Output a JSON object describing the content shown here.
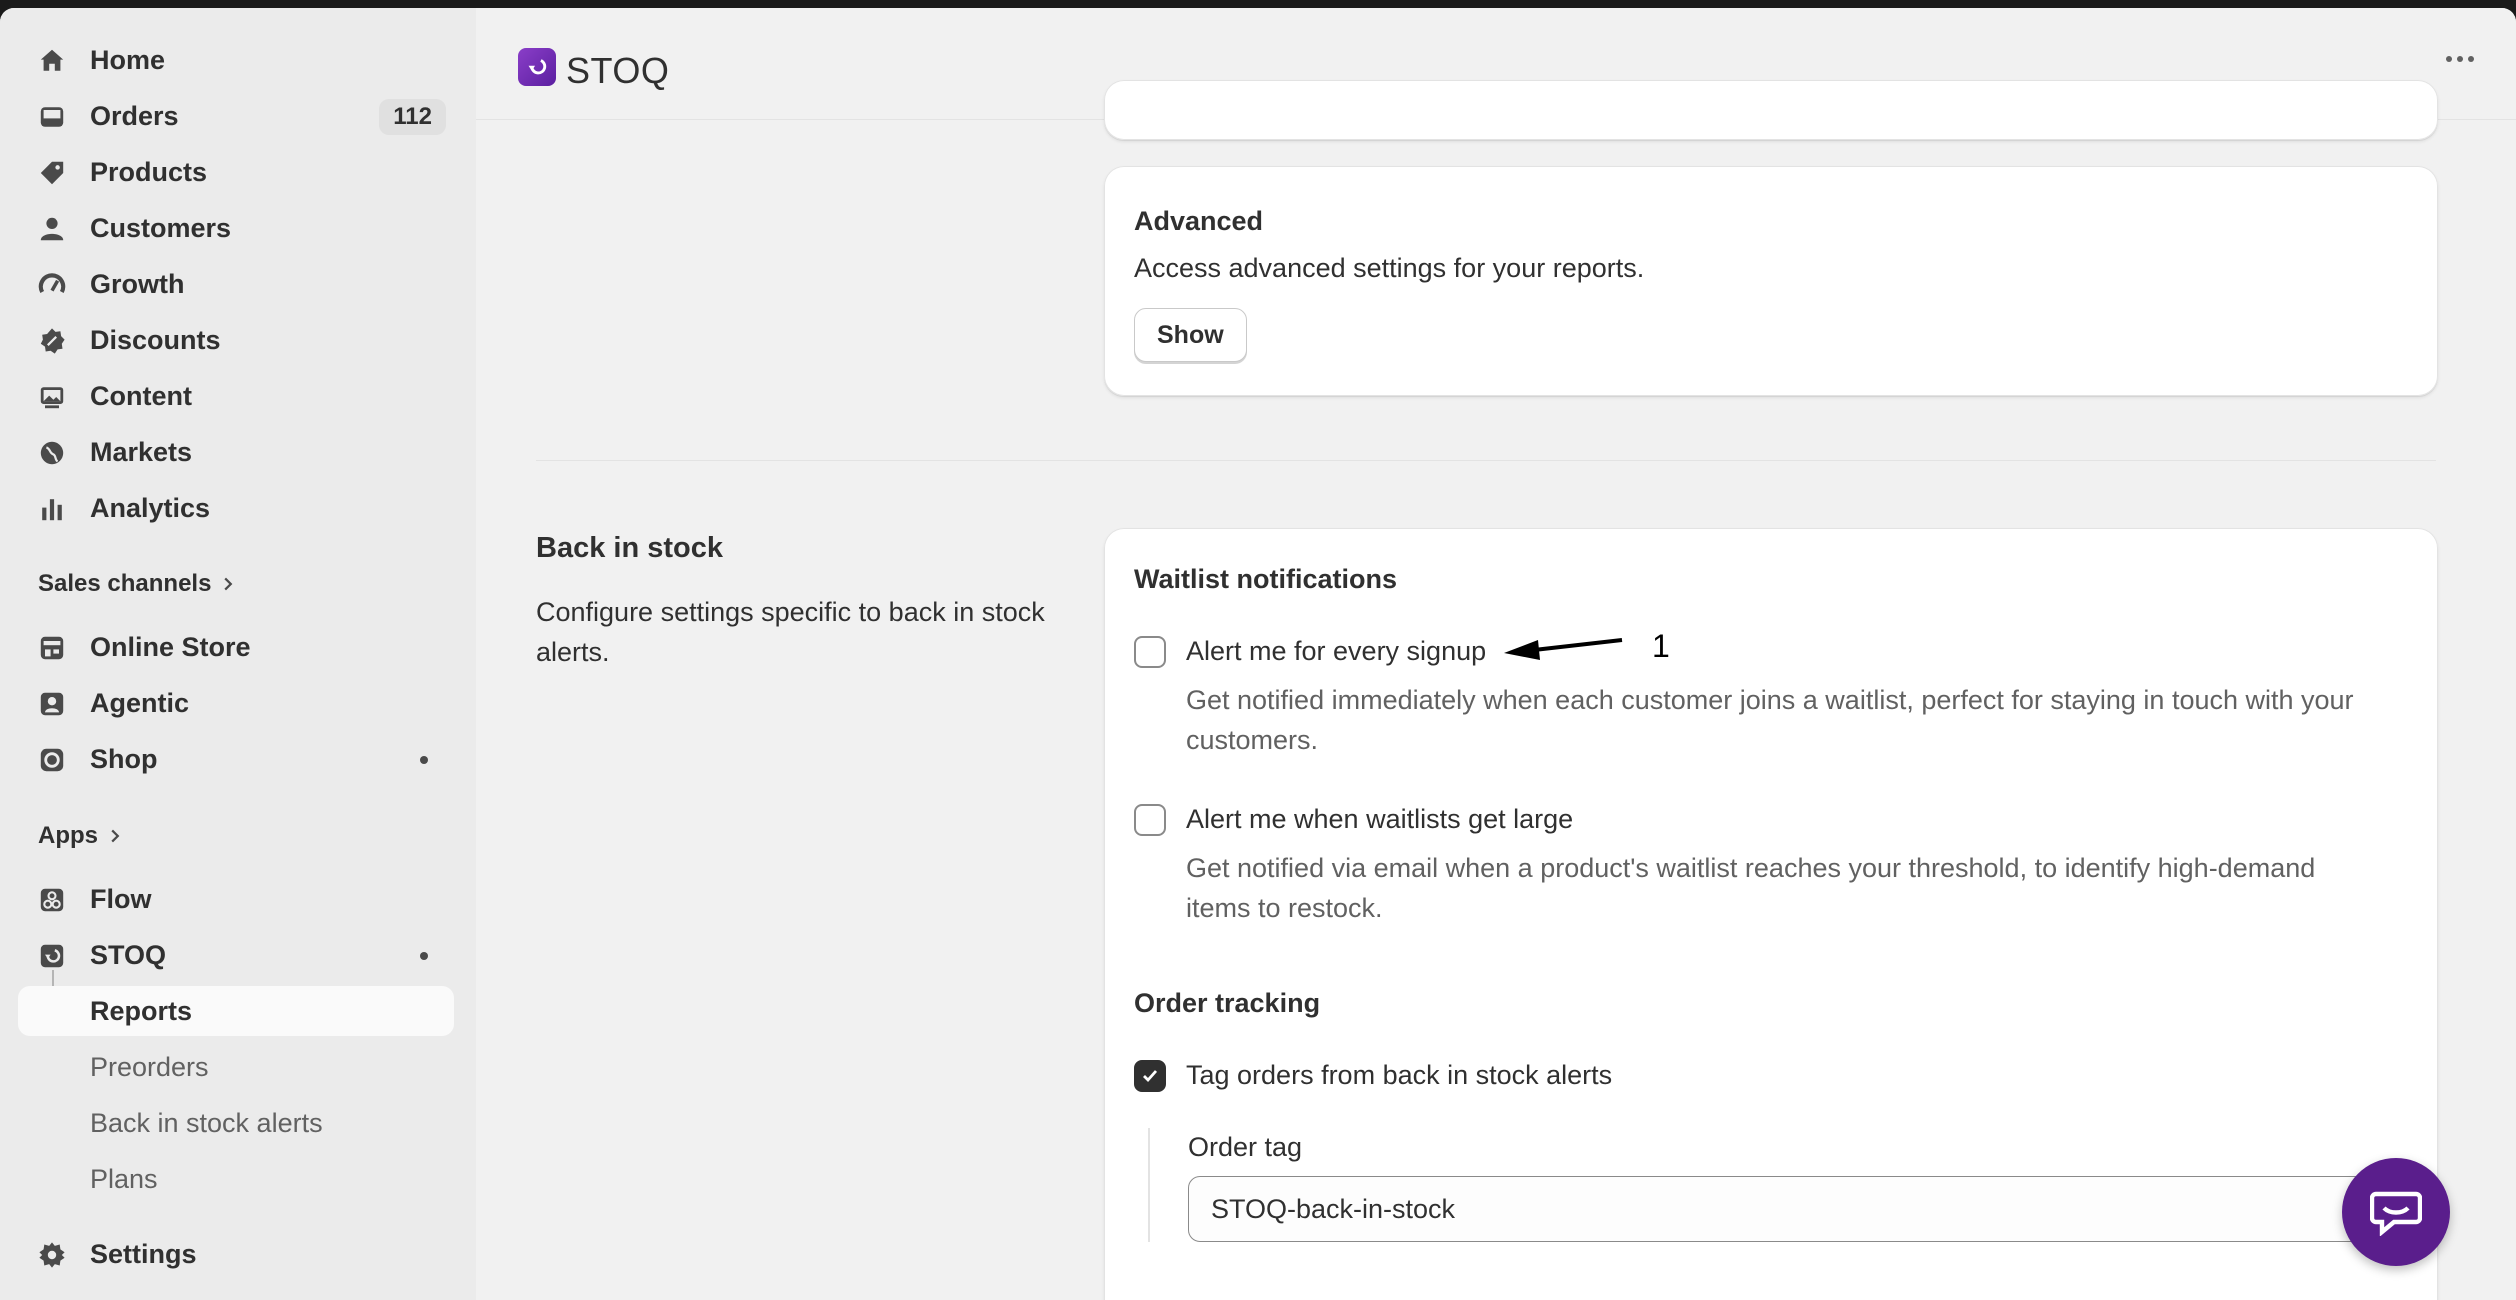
{
  "sidebar": {
    "main_items": [
      {
        "label": "Home",
        "icon": "home-icon"
      },
      {
        "label": "Orders",
        "icon": "inbox-icon",
        "badge": "112"
      },
      {
        "label": "Products",
        "icon": "tag-icon"
      },
      {
        "label": "Customers",
        "icon": "person-icon"
      },
      {
        "label": "Growth",
        "icon": "gauge-icon"
      },
      {
        "label": "Discounts",
        "icon": "discount-icon"
      },
      {
        "label": "Content",
        "icon": "image-icon"
      },
      {
        "label": "Markets",
        "icon": "globe-icon"
      },
      {
        "label": "Analytics",
        "icon": "bar-chart-icon"
      }
    ],
    "sales_channels_label": "Sales channels",
    "channels": [
      {
        "label": "Online Store",
        "icon": "store-icon"
      },
      {
        "label": "Agentic",
        "icon": "robot-icon"
      },
      {
        "label": "Shop",
        "icon": "shop-icon"
      }
    ],
    "apps_label": "Apps",
    "apps": [
      {
        "label": "Flow",
        "icon": "flow-icon"
      },
      {
        "label": "STOQ",
        "icon": "stoq-icon"
      }
    ],
    "stoq_subitems": [
      "Reports",
      "Preorders",
      "Back in stock alerts",
      "Plans"
    ],
    "settings_label": "Settings"
  },
  "header": {
    "app_title": "STOQ"
  },
  "advanced_card": {
    "title": "Advanced",
    "description": "Access advanced settings for your reports.",
    "button_label": "Show"
  },
  "back_in_stock": {
    "title": "Back in stock",
    "description": "Configure settings specific to back in stock alerts."
  },
  "waitlist": {
    "title": "Waitlist notifications",
    "options": [
      {
        "label": "Alert me for every signup",
        "help": "Get notified immediately when each customer joins a waitlist, perfect for staying in touch with your customers.",
        "checked": false
      },
      {
        "label": "Alert me when waitlists get large",
        "help": "Get notified via email when a product's waitlist reaches your threshold, to identify high-demand items to restock.",
        "checked": false
      }
    ]
  },
  "order_tracking": {
    "title": "Order tracking",
    "checkbox_label": "Tag orders from back in stock alerts",
    "checked": true,
    "field_label": "Order tag",
    "field_value": "STOQ-back-in-stock"
  },
  "annotation": {
    "label": "1"
  },
  "colors": {
    "accent": "#5a1e8c",
    "sidebar_bg": "#ebebeb",
    "page_bg": "#f1f1f1"
  }
}
